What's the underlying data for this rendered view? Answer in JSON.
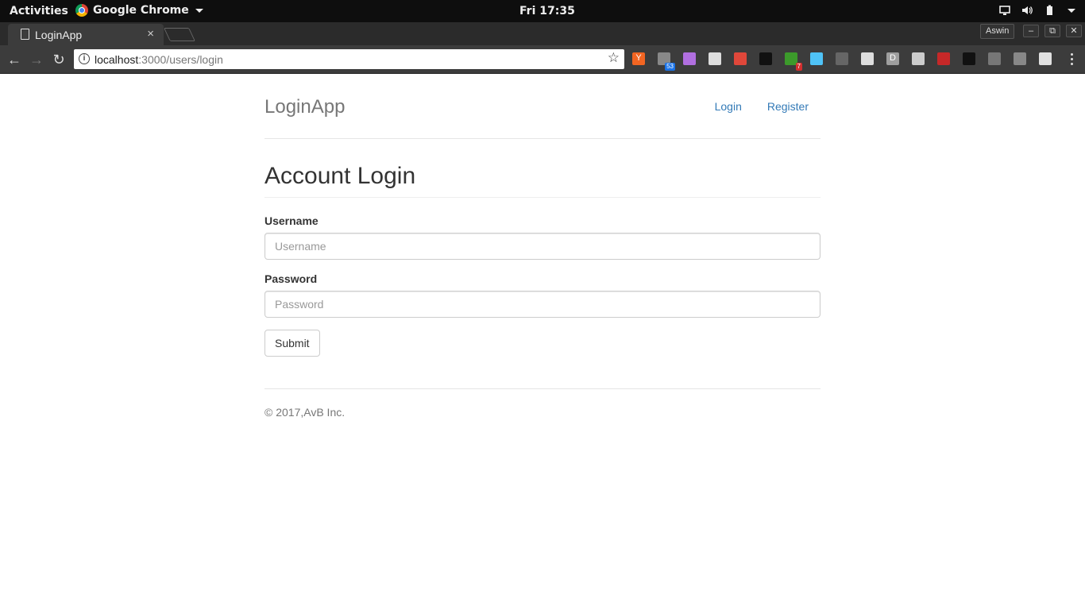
{
  "system_bar": {
    "activities": "Activities",
    "app_name": "Google Chrome",
    "clock": "Fri 17:35"
  },
  "browser": {
    "tab_title": "LoginApp",
    "tab_close": "×",
    "user": "Aswin",
    "url_host": "localhost",
    "url_rest": ":3000/users/login",
    "extensions": [
      {
        "name": "y-icon",
        "color": "#f26522",
        "label": "Y"
      },
      {
        "name": "badge-ext-icon",
        "color": "#888888",
        "badge": "53",
        "badge_color": "#1a73e8"
      },
      {
        "name": "purple-ext-icon",
        "color": "#b16fe0"
      },
      {
        "name": "printer-ext-icon",
        "color": "#dddddd"
      },
      {
        "name": "color-wheel-icon",
        "color": "#e0473a"
      },
      {
        "name": "gnome-foot-icon",
        "color": "#111111"
      },
      {
        "name": "download-arrow-icon",
        "color": "#3c9a2b",
        "badge": "7",
        "badge_color": "#d32f2f"
      },
      {
        "name": "heart-icon",
        "color": "#4fc3f7"
      },
      {
        "name": "youtube-icon",
        "color": "#666666"
      },
      {
        "name": "puzzle-ext-icon",
        "color": "#dddddd"
      },
      {
        "name": "d-ext-icon",
        "color": "#9e9e9e",
        "label": "D"
      },
      {
        "name": "shield-ext-icon",
        "color": "#cccccc"
      },
      {
        "name": "red-ext-icon",
        "color": "#c62828"
      },
      {
        "name": "magnifier-ext-icon",
        "color": "#111111"
      },
      {
        "name": "github-icon",
        "color": "#777777"
      },
      {
        "name": "search-ext-icon",
        "color": "#888888"
      },
      {
        "name": "striped-ext-icon",
        "color": "#e0e0e0"
      }
    ]
  },
  "app": {
    "brand": "LoginApp",
    "nav": {
      "login": "Login",
      "register": "Register"
    },
    "heading": "Account Login",
    "username": {
      "label": "Username",
      "placeholder": "Username"
    },
    "password": {
      "label": "Password",
      "placeholder": "Password"
    },
    "submit": "Submit",
    "footer": "© 2017,AvB Inc."
  }
}
